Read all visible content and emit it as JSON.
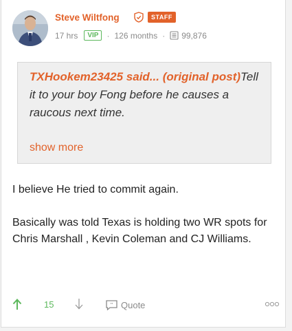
{
  "post": {
    "author": {
      "name": "Steve Wiltfong",
      "role_badge": "STAFF",
      "time_ago": "17 hrs",
      "membership_badge": "VIP",
      "tenure": "126 months",
      "post_count": "99,876"
    },
    "quote": {
      "author_said": "TXHookem23425 said...",
      "link_text": "(original post)",
      "text": "Tell it to your boy Fong before he causes a raucous next time.",
      "show_more": "show more"
    },
    "body": [
      "I believe He tried to commit again.",
      "Basically was told Texas is holding two WR spots for Chris Marshall , Kevin Coleman and CJ Williams."
    ],
    "actions": {
      "vote_count": "15",
      "quote_label": "Quote"
    }
  },
  "colors": {
    "accent": "#e2622a",
    "vip_green": "#5cb85c",
    "muted": "#8a8a8a",
    "quote_bg": "#efefef"
  },
  "icons": {
    "staff": "shield-icon",
    "posts": "posts-icon",
    "upvote": "arrow-up-icon",
    "downvote": "arrow-down-icon",
    "quote": "quote-icon",
    "more": "more-icon"
  }
}
